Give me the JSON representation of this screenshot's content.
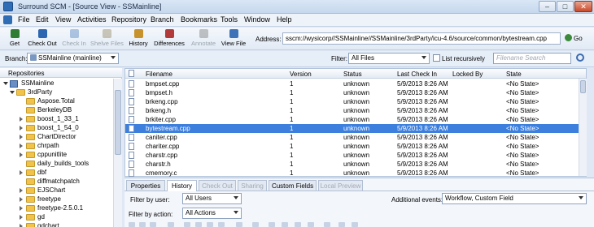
{
  "window": {
    "title": "Surround SCM - [Source View - SSMainline]",
    "controls": {
      "minimize": "–",
      "maximize": "□",
      "close": "✕"
    }
  },
  "menu": [
    "File",
    "Edit",
    "View",
    "Activities",
    "Repository",
    "Branch",
    "Bookmarks",
    "Tools",
    "Window",
    "Help"
  ],
  "toolbar": {
    "buttons": [
      {
        "label": "Get",
        "enabled": true,
        "icon": "get-icon",
        "color": "#2f7d32"
      },
      {
        "label": "Check Out",
        "enabled": true,
        "icon": "checkout-icon",
        "color": "#2c66b0"
      },
      {
        "label": "Check In",
        "enabled": false,
        "icon": "checkin-icon",
        "color": "#2c66b0"
      },
      {
        "label": "Shelve Files",
        "enabled": false,
        "icon": "shelve-icon",
        "color": "#7a6a3c"
      },
      {
        "label": "History",
        "enabled": true,
        "icon": "history-icon",
        "color": "#c7922b"
      },
      {
        "label": "Differences",
        "enabled": true,
        "icon": "differences-icon",
        "color": "#b23a3a"
      },
      {
        "label": "Annotate",
        "enabled": false,
        "icon": "annotate-icon",
        "color": "#5c5c5c"
      },
      {
        "label": "View File",
        "enabled": true,
        "icon": "view-file-icon",
        "color": "#3e73b8"
      }
    ],
    "address_label": "Address:",
    "address_value": "sscm://wysicorp//SSMainline//SSMainline/3rdParty/icu-4.6/source/common/bytestream.cpp",
    "go_label": "Go"
  },
  "branch_row": {
    "branch_label": "Branch:",
    "branch_value": "SSMainline (mainline)",
    "filter_label": "Filter:",
    "filter_value": "All Files",
    "recursive_label": "List recursively",
    "recursive_checked": false,
    "search_placeholder": "Filename Search"
  },
  "tree": {
    "header": "Repositories",
    "nodes": [
      {
        "label": "SSMainline",
        "depth": 0,
        "expanded": true,
        "type": "root"
      },
      {
        "label": "3rdParty",
        "depth": 1,
        "expanded": true,
        "type": "folder"
      },
      {
        "label": "Aspose.Total",
        "depth": 2,
        "expanded": false,
        "type": "folder",
        "expander": false
      },
      {
        "label": "BerkeleyDB",
        "depth": 2,
        "expanded": false,
        "type": "folder",
        "expander": false
      },
      {
        "label": "boost_1_33_1",
        "depth": 2,
        "expanded": false,
        "type": "folder",
        "expander": true
      },
      {
        "label": "boost_1_54_0",
        "depth": 2,
        "expanded": false,
        "type": "folder",
        "expander": true
      },
      {
        "label": "ChartDirector",
        "depth": 2,
        "expanded": false,
        "type": "folder",
        "expander": true
      },
      {
        "label": "chrpath",
        "depth": 2,
        "expanded": false,
        "type": "folder",
        "expander": true
      },
      {
        "label": "cppunitlite",
        "depth": 2,
        "expanded": false,
        "type": "folder",
        "expander": true
      },
      {
        "label": "daily_builds_tools",
        "depth": 2,
        "expanded": false,
        "type": "folder",
        "expander": false
      },
      {
        "label": "dbf",
        "depth": 2,
        "expanded": false,
        "type": "folder",
        "expander": true
      },
      {
        "label": "diffmatchpatch",
        "depth": 2,
        "expanded": false,
        "type": "folder",
        "expander": false
      },
      {
        "label": "EJSChart",
        "depth": 2,
        "expanded": false,
        "type": "folder",
        "expander": true
      },
      {
        "label": "freetype",
        "depth": 2,
        "expanded": false,
        "type": "folder",
        "expander": true
      },
      {
        "label": "freetype-2.5.0.1",
        "depth": 2,
        "expanded": false,
        "type": "folder",
        "expander": true
      },
      {
        "label": "gd",
        "depth": 2,
        "expanded": false,
        "type": "folder",
        "expander": true
      },
      {
        "label": "gdchart",
        "depth": 2,
        "expanded": false,
        "type": "folder",
        "expander": true
      }
    ]
  },
  "filelist": {
    "columns": [
      "Filename",
      "Version",
      "Status",
      "Last Check In",
      "Locked By",
      "State"
    ],
    "rows": [
      {
        "filename": "bmpset.cpp",
        "version": "1",
        "status": "unknown",
        "last_check_in": "5/9/2013 8:26 AM",
        "locked_by": "",
        "state": "<No State>",
        "selected": false
      },
      {
        "filename": "bmpset.h",
        "version": "1",
        "status": "unknown",
        "last_check_in": "5/9/2013 8:26 AM",
        "locked_by": "",
        "state": "<No State>",
        "selected": false
      },
      {
        "filename": "brkeng.cpp",
        "version": "1",
        "status": "unknown",
        "last_check_in": "5/9/2013 8:26 AM",
        "locked_by": "",
        "state": "<No State>",
        "selected": false
      },
      {
        "filename": "brkeng.h",
        "version": "1",
        "status": "unknown",
        "last_check_in": "5/9/2013 8:26 AM",
        "locked_by": "",
        "state": "<No State>",
        "selected": false
      },
      {
        "filename": "brkiter.cpp",
        "version": "1",
        "status": "unknown",
        "last_check_in": "5/9/2013 8:26 AM",
        "locked_by": "",
        "state": "<No State>",
        "selected": false
      },
      {
        "filename": "bytestream.cpp",
        "version": "1",
        "status": "unknown",
        "last_check_in": "5/9/2013 8:26 AM",
        "locked_by": "",
        "state": "<No State>",
        "selected": true
      },
      {
        "filename": "caniter.cpp",
        "version": "1",
        "status": "unknown",
        "last_check_in": "5/9/2013 8:26 AM",
        "locked_by": "",
        "state": "<No State>",
        "selected": false
      },
      {
        "filename": "chariter.cpp",
        "version": "1",
        "status": "unknown",
        "last_check_in": "5/9/2013 8:26 AM",
        "locked_by": "",
        "state": "<No State>",
        "selected": false
      },
      {
        "filename": "charstr.cpp",
        "version": "1",
        "status": "unknown",
        "last_check_in": "5/9/2013 8:26 AM",
        "locked_by": "",
        "state": "<No State>",
        "selected": false
      },
      {
        "filename": "charstr.h",
        "version": "1",
        "status": "unknown",
        "last_check_in": "5/9/2013 8:26 AM",
        "locked_by": "",
        "state": "<No State>",
        "selected": false
      },
      {
        "filename": "cmemory.c",
        "version": "1",
        "status": "unknown",
        "last_check_in": "5/9/2013 8:26 AM",
        "locked_by": "",
        "state": "<No State>",
        "selected": false
      }
    ]
  },
  "bottom": {
    "tabs": [
      {
        "label": "Properties",
        "active": false,
        "enabled": true
      },
      {
        "label": "History",
        "active": true,
        "enabled": true
      },
      {
        "label": "Check Out",
        "active": false,
        "enabled": false
      },
      {
        "label": "Sharing",
        "active": false,
        "enabled": false
      },
      {
        "label": "Custom Fields",
        "active": false,
        "enabled": true
      },
      {
        "label": "Local Preview",
        "active": false,
        "enabled": false
      }
    ],
    "filter_user_label": "Filter by user:",
    "filter_user_value": "All Users",
    "filter_action_label": "Filter by action:",
    "filter_action_value": "All Actions",
    "events_label": "Additional events:",
    "events_value": "Workflow, Custom Field"
  }
}
